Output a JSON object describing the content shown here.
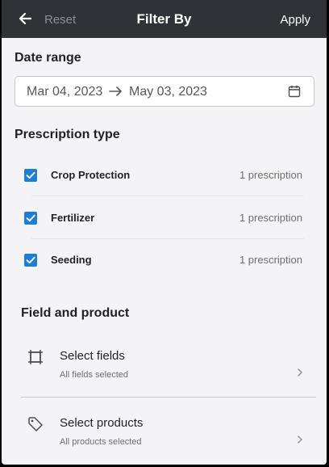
{
  "header": {
    "reset_label": "Reset",
    "title": "Filter By",
    "apply_label": "Apply",
    "back_icon": "arrow-left-icon"
  },
  "date_range": {
    "title": "Date range",
    "start": "Mar 04, 2023",
    "end": "May 03, 2023",
    "icons": [
      "arrow-right-icon",
      "calendar-icon"
    ]
  },
  "prescription_type": {
    "title": "Prescription type",
    "items": [
      {
        "label": "Crop Protection",
        "count": "1 prescription",
        "checked": true
      },
      {
        "label": "Fertilizer",
        "count": "1 prescription",
        "checked": true
      },
      {
        "label": "Seeding",
        "count": "1 prescription",
        "checked": true
      }
    ]
  },
  "field_and_product": {
    "title": "Field and product",
    "items": [
      {
        "label": "Select fields",
        "sub": "All fields selected",
        "icon": "field-boundary-icon"
      },
      {
        "label": "Select products",
        "sub": "All products selected",
        "icon": "tag-icon"
      }
    ]
  },
  "colors": {
    "header_bg": "#303237",
    "page_bg": "#f4f4f6",
    "checkbox_accent": "#1a7fd6"
  }
}
